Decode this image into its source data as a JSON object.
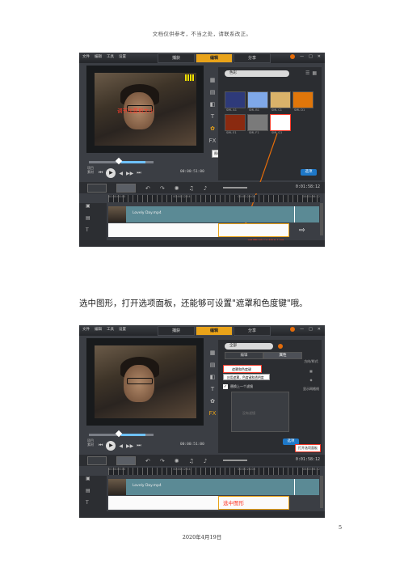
{
  "header_note": "文档仅供参考，不当之处，请联系改正。",
  "caption": "选中图形，打开选项面板，还能够可设置\"遮罩和色度键\"哦。",
  "page_number": "5",
  "footer_date": "2020年4月19日",
  "editor": {
    "menu": [
      "文件",
      "编辑",
      "工具",
      "设置"
    ],
    "steps": [
      "捕获",
      "编辑",
      "分享"
    ],
    "active_step": "编辑",
    "window_buttons": [
      "?",
      "—",
      "□",
      "✕"
    ],
    "mode_labels": [
      "项目",
      "素材"
    ],
    "transport": [
      "⏮",
      "◀",
      "▶",
      "▶▶",
      "⏭"
    ],
    "timecode": "00:00:51:00",
    "timeline_time": "0:01:58:12",
    "ruler_labels": [
      "00:00:00:00",
      "00:00:06:02",
      "00:00:12:04",
      "00:00:18:06",
      "00:00:24:08",
      "00:00:30:10",
      "00:00:36:12",
      "00:00:42:14"
    ],
    "clip_label": "Lovely Day.mp4"
  },
  "screenshot1": {
    "annotation_video": "调节位置和大小",
    "annotation_timeline": "调节遮栏的时间",
    "tooltip": "图形",
    "library_select": "色彩",
    "options_button": "选项",
    "swatches": [
      {
        "label": "SML A1",
        "color": "#2e3a7a"
      },
      {
        "label": "SML B1",
        "color": "#7fa8e8"
      },
      {
        "label": "SML C1",
        "color": "#d9b26a"
      },
      {
        "label": "SML D1",
        "color": "#e0760a"
      },
      {
        "label": "SML E1",
        "color": "#8a2a10"
      },
      {
        "label": "SML F1",
        "color": "#7a7a7a"
      },
      {
        "label": "SML G1",
        "color": "#ffffff"
      }
    ]
  },
  "screenshot2": {
    "annotation_timeline": "选中图形",
    "panel_select": "全部",
    "panel_tabs": [
      "编辑",
      "属性"
    ],
    "active_tab": "属性",
    "mask_button": "遮罩和色度键",
    "mask_tooltip": "应用遮罩，色度键和透明度",
    "check_label": "替换上一个滤镜",
    "empty_text": "没有滤镜",
    "side_labels": [
      "方向/样式",
      "显示网格线"
    ],
    "options_button": "选项",
    "open_panel_tooltip": "打开选项面板"
  },
  "colors": {
    "accent_orange": "#e9a319",
    "annotation_red": "#ff3b2a",
    "app_background": "#3b3e44",
    "clip_teal": "#5b8a95"
  }
}
